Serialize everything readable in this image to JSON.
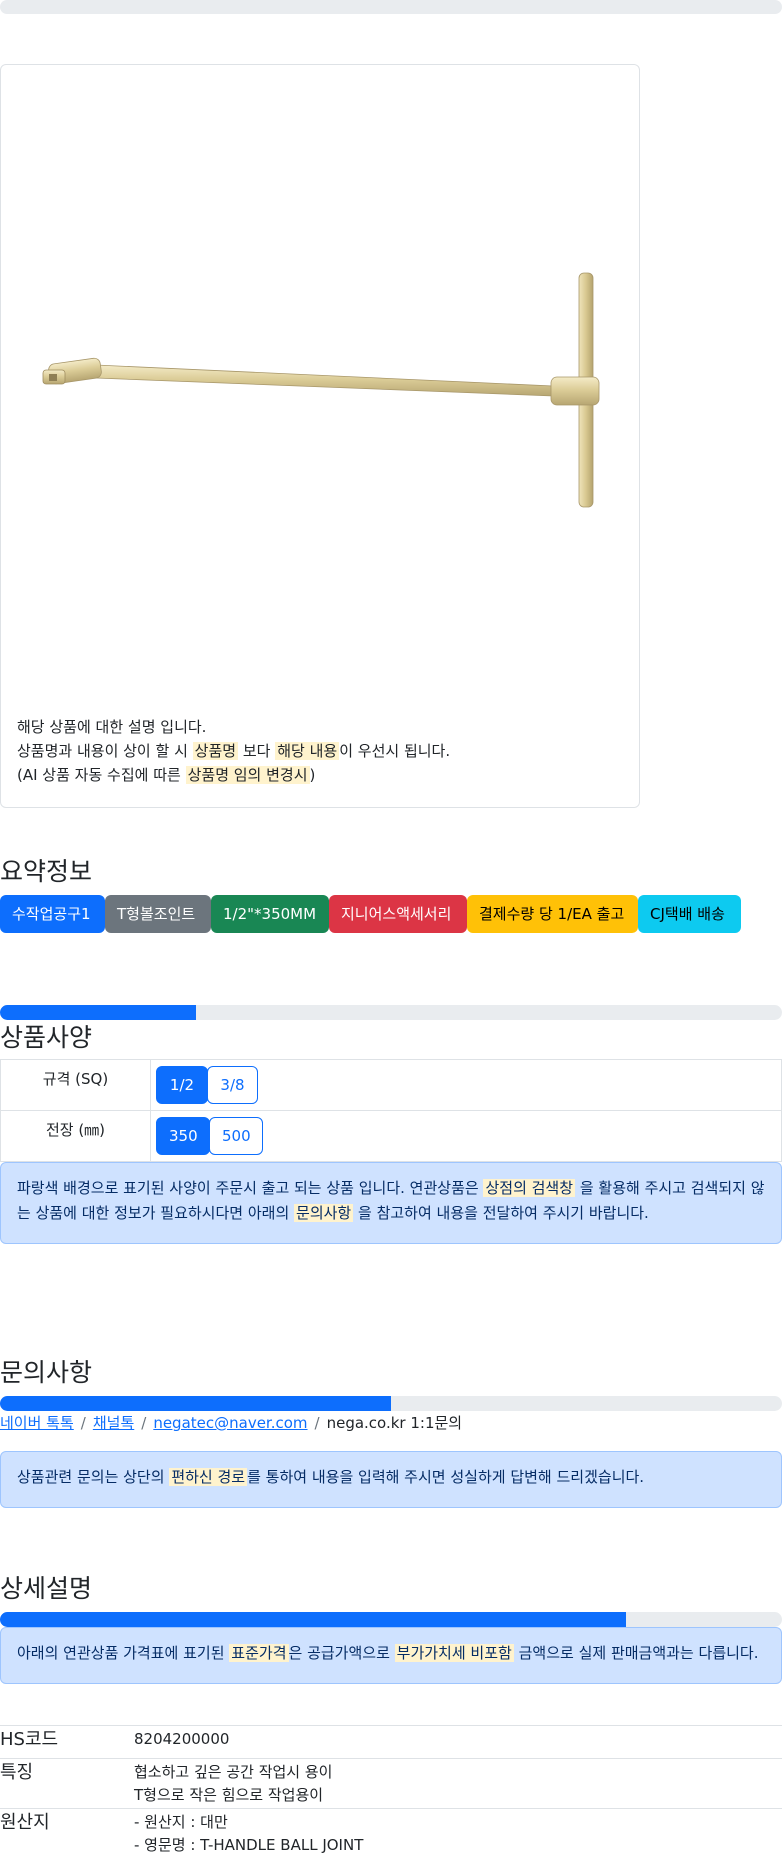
{
  "product": {
    "image_alt": "T-handle ball joint wrench",
    "notes": {
      "line1": "해당 상품에 대한 설명 입니다.",
      "line2_a": "상품명과 내용이 상이 할 시",
      "line2_hl1": "상품명",
      "line2_b": "보다",
      "line2_hl2": "해당 내용",
      "line2_c": "이 우선시 됩니다.",
      "line3_a": "(AI 상품 자동 수집에 따른",
      "line3_hl": "상품명 임의 변경시",
      "line3_b": ")"
    }
  },
  "summary": {
    "title": "요약정보",
    "badges": [
      {
        "label": "수작업공구1",
        "color": "#0d6efd",
        "text_color": "#ffffff"
      },
      {
        "label": "T형볼조인트",
        "color": "#6c757d",
        "text_color": "#ffffff"
      },
      {
        "label": "1/2\"*350MM",
        "color": "#198754",
        "text_color": "#ffffff"
      },
      {
        "label": "지니어스액세서리",
        "color": "#dc3545",
        "text_color": "#ffffff"
      },
      {
        "label": "결제수량 당 1/EA 출고",
        "color": "#ffc107",
        "text_color": "#000000"
      },
      {
        "label": "CJ택배 배송",
        "color": "#0dcaf0",
        "text_color": "#000000"
      }
    ]
  },
  "progress": {
    "spec": 25,
    "inquiry": 50,
    "detail": 80
  },
  "spec": {
    "title": "상품사양",
    "rows": [
      {
        "label": "규격 (SQ)",
        "options": [
          "1/2",
          "3/8"
        ],
        "selected": "1/2"
      },
      {
        "label": "전장 (㎜)",
        "options": [
          "350",
          "500"
        ],
        "selected": "350"
      }
    ],
    "alert": {
      "a": "파랑색 배경으로 표기된 사양이 주문시 출고 되는 상품 입니다. 연관상품은",
      "hl1": "상점의 검색창",
      "b": "을 활용해 주시고 검색되지 않",
      "c": "는 상품에 대한 정보가 필요하시다면 아래의",
      "hl2": "문의사항",
      "d": "을 참고하여 내용을 전달하여 주시기 바랍니다."
    }
  },
  "inquiry": {
    "title": "문의사항",
    "links": [
      "네이버 톡톡",
      "채널톡",
      "negatec@naver.com"
    ],
    "plain": "nega.co.kr 1:1문의",
    "separator": "/",
    "alert": {
      "a": "상품관련 문의는 상단의",
      "hl": "편하신 경로",
      "b": "를 통하여 내용을 입력해 주시면 성실하게 답변해 드리겠습니다."
    }
  },
  "detail": {
    "title": "상세설명",
    "alert": {
      "a": "아래의 연관상품 가격표에 표기된",
      "hl1": "표준가격",
      "b": "은 공급가액으로",
      "hl2": "부가가치세 비포함",
      "c": "금액으로 실제 판매금액과는 다릅니다."
    },
    "info": [
      {
        "key": "HS코드",
        "values": [
          "8204200000"
        ]
      },
      {
        "key": "특징",
        "values": [
          "협소하고 깊은 공간 작업시 용이",
          "T형으로 작은 힘으로 작업용이"
        ]
      },
      {
        "key": "원산지",
        "values": [
          "- 원산지 : 대만",
          "- 영문명 : T-HANDLE BALL JOINT"
        ]
      }
    ]
  }
}
